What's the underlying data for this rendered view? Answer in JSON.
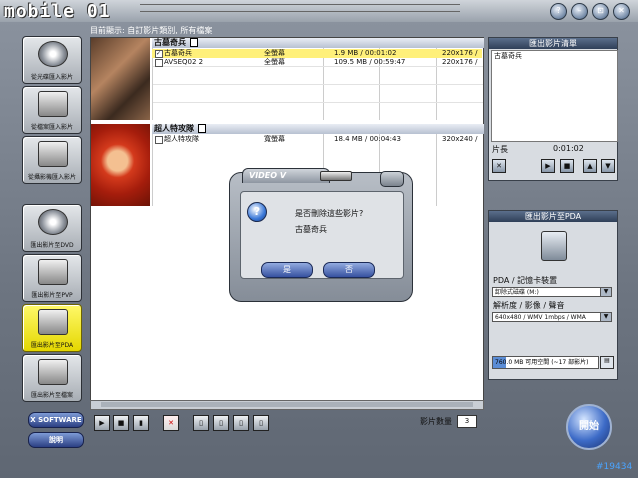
{
  "app": {
    "logo": "mobile 01"
  },
  "window_controls": [
    "?",
    "–",
    "⊡",
    "✕"
  ],
  "status": {
    "text": "目前顯示: 自訂影片類別, 所有檔案"
  },
  "sidebar": {
    "items": [
      {
        "label": "從光碟匯入影片"
      },
      {
        "label": "從檔案匯入影片"
      },
      {
        "label": "從攝影機匯入影片"
      },
      {
        "label": "匯出影片至DVD"
      },
      {
        "label": "匯出影片至PVP"
      },
      {
        "label": "匯出影片至PDA"
      },
      {
        "label": "匯出影片至檔案"
      }
    ],
    "brand_button": "X SOFTWARE",
    "help_button": "說明"
  },
  "movies": [
    {
      "title": "古墓奇兵",
      "rows": [
        {
          "checked": true,
          "name": "古墓奇兵",
          "aspect": "全螢幕",
          "info": "1.9 MB / 00:01:02",
          "res": "220x176 /"
        },
        {
          "checked": false,
          "name": "AVSEQ02 2",
          "aspect": "全螢幕",
          "info": "109.5 MB / 00:59:47",
          "res": "220x176 /"
        }
      ]
    },
    {
      "title": "超人特攻隊",
      "rows": [
        {
          "checked": false,
          "name": "超人特攻隊",
          "aspect": "寬螢幕",
          "info": "18.4 MB / 00:04:43",
          "res": "320x240 /"
        }
      ]
    }
  ],
  "footer": {
    "count_label": "影片數量",
    "count_value": "3"
  },
  "playlist": {
    "title": "匯出影片清單",
    "items": [
      "古墓奇兵"
    ],
    "length_label": "片長",
    "length_value": "0:01:02"
  },
  "pda": {
    "title": "匯出影片至PDA",
    "device_label": "PDA / 記憶卡裝置",
    "device_value": "卸除式磁碟 (M:)",
    "quality_label": "解析度 / 影像 / 聲音",
    "quality_value": "640x480 / WMV 1mbps / WMA",
    "space_value": "760.0",
    "space_text": "MB 可用空間 (~17 部影片)",
    "space_fill": 0.12
  },
  "start_button": "開始",
  "watermark": "#19434",
  "dialog": {
    "tab_title": "VIDEO V",
    "message": "是否刪除這些影片?",
    "item": "古墓奇兵",
    "yes": "是",
    "no": "否"
  },
  "colors": {
    "selected_row": "#fff07a",
    "start": "#3d6bc7",
    "active_sidebar": "#fff96a"
  }
}
